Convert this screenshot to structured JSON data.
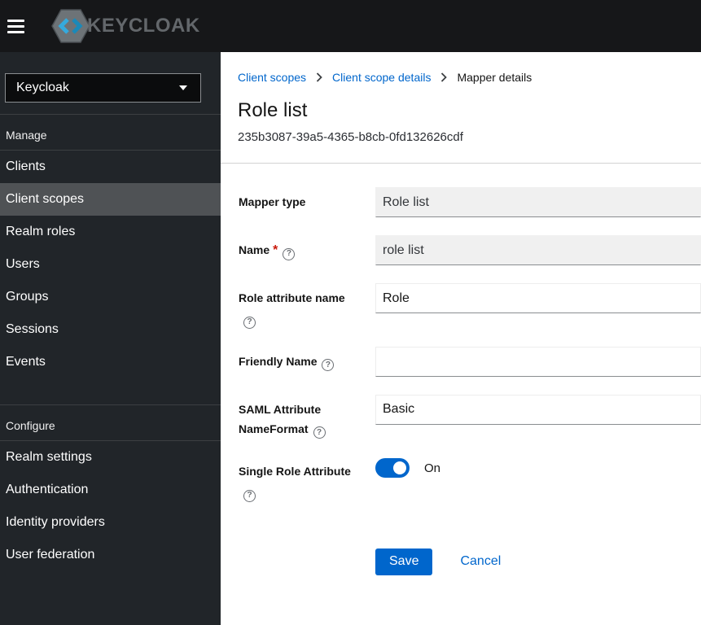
{
  "topbar": {
    "logo_text": "KEYCLOAK"
  },
  "sidebar": {
    "realm_selector": {
      "value": "Keycloak"
    },
    "groups": [
      {
        "title": "Manage",
        "items": [
          {
            "label": "Clients",
            "selected": false
          },
          {
            "label": "Client scopes",
            "selected": true
          },
          {
            "label": "Realm roles",
            "selected": false
          },
          {
            "label": "Users",
            "selected": false
          },
          {
            "label": "Groups",
            "selected": false
          },
          {
            "label": "Sessions",
            "selected": false
          },
          {
            "label": "Events",
            "selected": false
          }
        ]
      },
      {
        "title": "Configure",
        "items": [
          {
            "label": "Realm settings",
            "selected": false
          },
          {
            "label": "Authentication",
            "selected": false
          },
          {
            "label": "Identity providers",
            "selected": false
          },
          {
            "label": "User federation",
            "selected": false
          }
        ]
      }
    ]
  },
  "breadcrumb": [
    {
      "label": "Client scopes"
    },
    {
      "label": "Client scope details"
    },
    {
      "label": "Mapper details"
    }
  ],
  "header": {
    "title": "Role list",
    "subtitle": "235b3087-39a5-4365-b8cb-0fd132626cdf"
  },
  "form": {
    "required_marker": "*",
    "fields": [
      {
        "label": "Mapper type",
        "value": "Role list",
        "disabled": true,
        "required": false,
        "help": false
      },
      {
        "label": "Name",
        "value": "role list",
        "disabled": true,
        "required": true,
        "help": true
      },
      {
        "label": "Role attribute name",
        "value": "Role",
        "disabled": false,
        "required": false,
        "help": true
      },
      {
        "label": "Friendly Name",
        "value": "",
        "disabled": false,
        "required": false,
        "help": true
      },
      {
        "label": "SAML Attribute NameFormat",
        "value": "Basic",
        "disabled": false,
        "required": false,
        "help": true
      },
      {
        "label": "Single Role Attribute",
        "type": "toggle",
        "state": "On",
        "help": true
      }
    ],
    "actions": {
      "save": "Save",
      "cancel": "Cancel"
    }
  },
  "icons": {
    "help": "?"
  },
  "colors": {
    "accent": "#0066cc",
    "link": "#0066cc",
    "topbar_bg": "#161719",
    "sidebar_bg": "#212529",
    "selected_item_bg": "#4f5255",
    "disabled_input_bg": "#f0f0f0",
    "required": "#c9190b",
    "logo_blue_light": "#35aadd",
    "logo_blue_dark": "#1b89b8"
  }
}
